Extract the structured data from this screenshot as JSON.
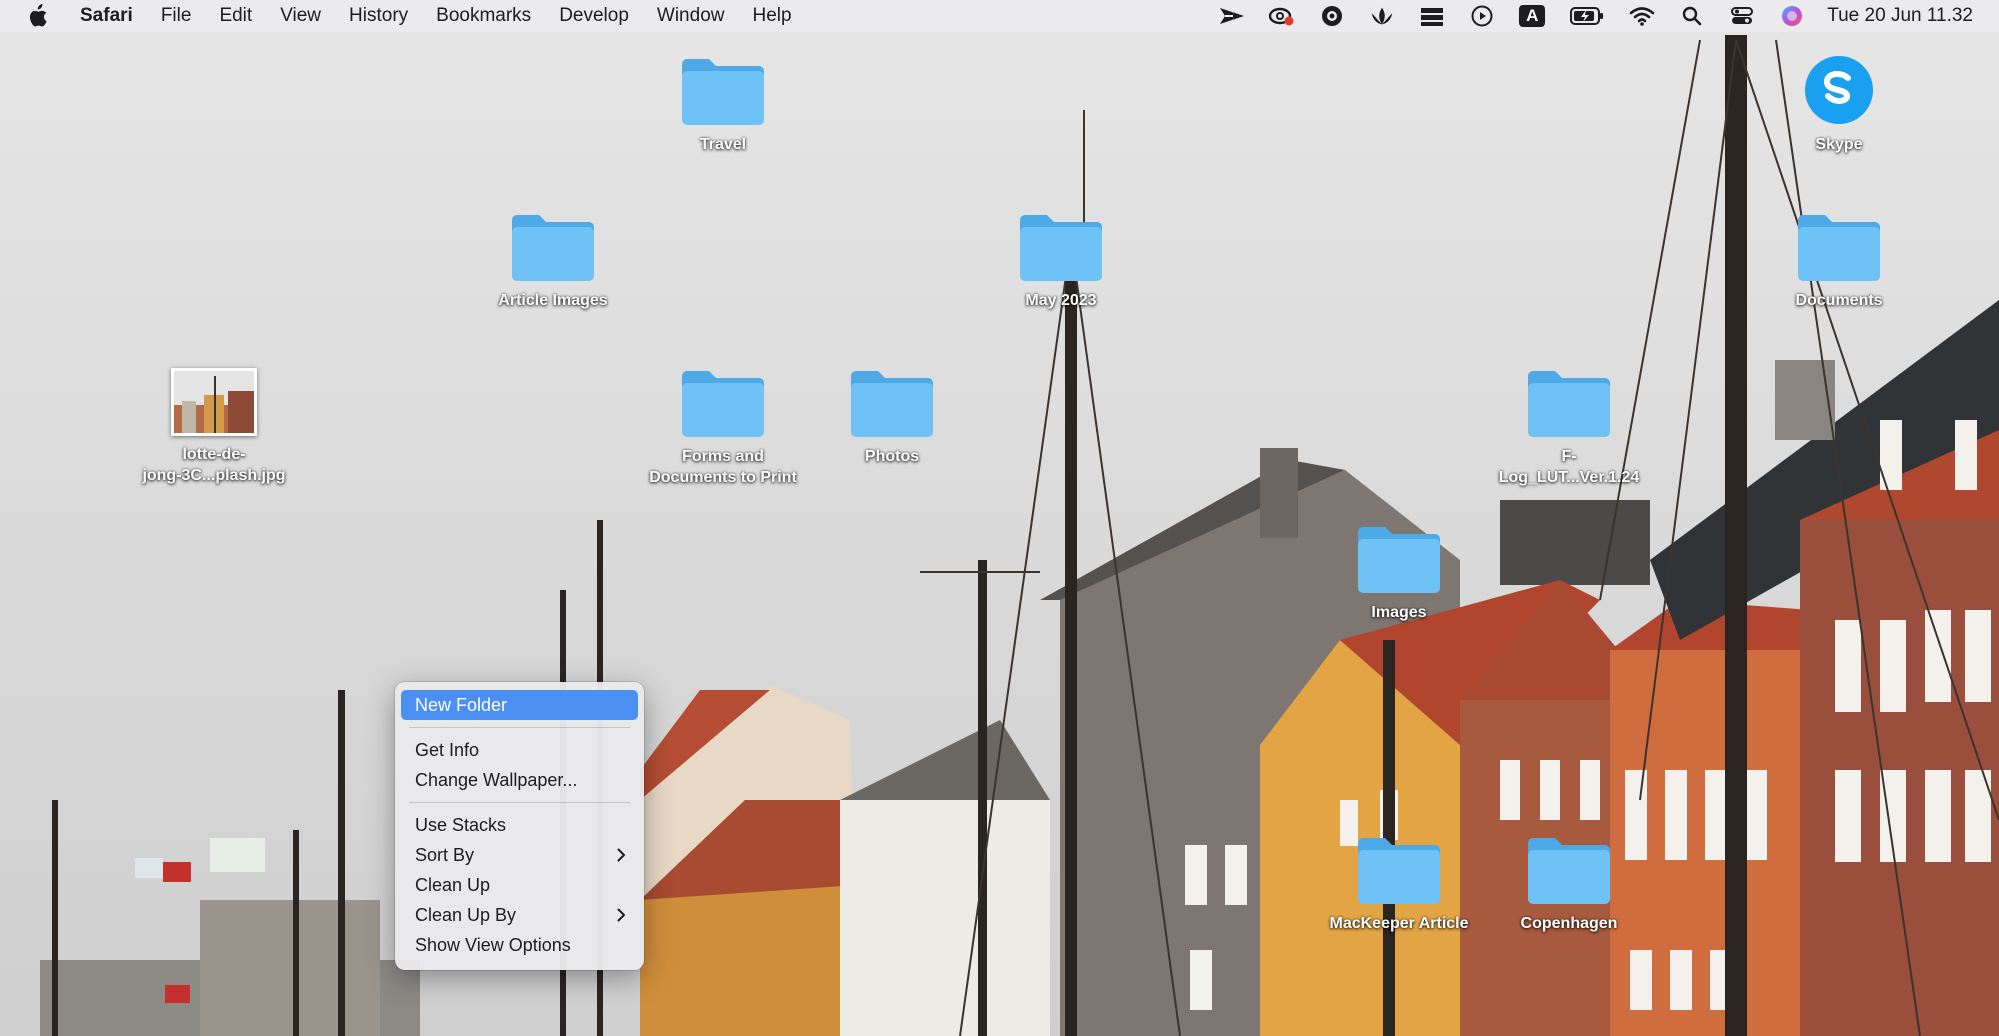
{
  "menubar": {
    "app_name": "Safari",
    "items": [
      "File",
      "Edit",
      "View",
      "History",
      "Bookmarks",
      "Develop",
      "Window",
      "Help"
    ],
    "status_icons": [
      "paper-plane-icon",
      "creative-cloud-icon",
      "camera-lens-icon",
      "lotus-icon",
      "books-icon",
      "play-circle-icon",
      "keyboard-a-icon",
      "battery-icon",
      "wifi-icon",
      "search-icon",
      "control-center-icon",
      "siri-icon"
    ],
    "input_source_label": "A",
    "clock": "Tue 20 Jun  11.32"
  },
  "desktop": {
    "icons": [
      {
        "label": "Travel",
        "kind": "folder"
      },
      {
        "label": "Skype",
        "kind": "app"
      },
      {
        "label": "Article Images",
        "kind": "folder"
      },
      {
        "label": "May 2023",
        "kind": "folder"
      },
      {
        "label": "Documents",
        "kind": "folder"
      },
      {
        "label": "lotte-de-\njong-3C...plash.jpg",
        "kind": "image"
      },
      {
        "label": "Forms and\nDocuments to Print",
        "kind": "folder"
      },
      {
        "label": "Photos",
        "kind": "folder"
      },
      {
        "label": "F-\nLog_LUT...Ver.1.24",
        "kind": "folder"
      },
      {
        "label": "Images",
        "kind": "folder"
      },
      {
        "label": "MacKeeper Article",
        "kind": "folder"
      },
      {
        "label": "Copenhagen",
        "kind": "folder"
      }
    ]
  },
  "context_menu": {
    "items": [
      {
        "label": "New Folder",
        "selected": true
      },
      {
        "separator": true
      },
      {
        "label": "Get Info"
      },
      {
        "label": "Change Wallpaper..."
      },
      {
        "separator": true
      },
      {
        "label": "Use Stacks"
      },
      {
        "label": "Sort By",
        "submenu": true
      },
      {
        "label": "Clean Up"
      },
      {
        "label": "Clean Up By",
        "submenu": true
      },
      {
        "label": "Show View Options"
      }
    ]
  },
  "colors": {
    "folder": "#6fc2f5",
    "highlight": "#4a8ff1",
    "skype": "#1aa0f0"
  }
}
